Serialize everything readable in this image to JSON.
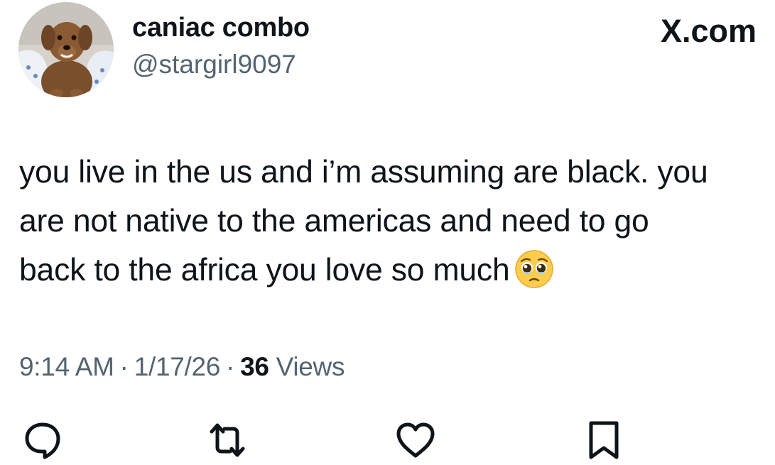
{
  "author": {
    "display_name": "caniac combo",
    "handle": "@stargirl9097",
    "avatar": "dog-photo-avatar"
  },
  "source": {
    "label": "X.com"
  },
  "tweet": {
    "lines": [
      "you live in the us and i’m assuming are black. you",
      "are not native to the americas and need to go",
      "back to the africa you love so much"
    ],
    "emoji": "pleading-face-emoji"
  },
  "meta": {
    "time": "9:14 AM",
    "date": "1/17/26",
    "separator": "·",
    "views_count": "36",
    "views_label": "Views"
  },
  "actions": [
    {
      "name": "reply",
      "icon": "reply-icon"
    },
    {
      "name": "repost",
      "icon": "repost-icon"
    },
    {
      "name": "like",
      "icon": "heart-icon"
    },
    {
      "name": "bookmark",
      "icon": "bookmark-icon"
    }
  ],
  "colors": {
    "text": "#0f1419",
    "secondary": "#536471",
    "background": "#ffffff"
  }
}
